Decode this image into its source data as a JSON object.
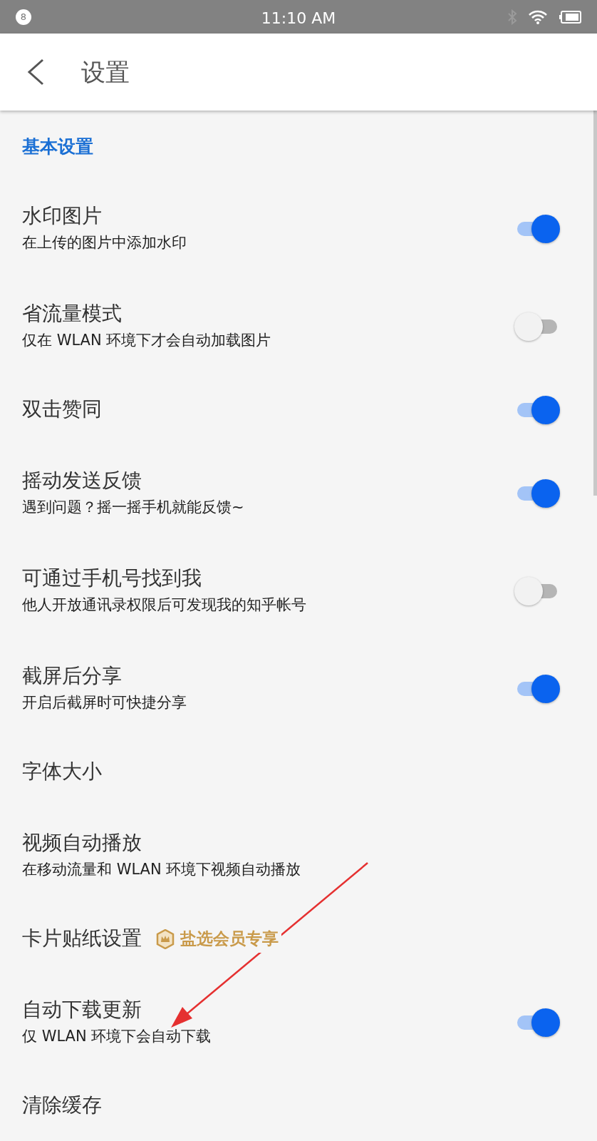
{
  "status_bar": {
    "notification_count": "8",
    "time": "11:10 AM"
  },
  "app_bar": {
    "title": "设置"
  },
  "section": {
    "title": "基本设置"
  },
  "settings": [
    {
      "kind": "toggle",
      "title": "水印图片",
      "subtitle": "在上传的图片中添加水印",
      "on": true
    },
    {
      "kind": "toggle",
      "title": "省流量模式",
      "subtitle": "仅在 WLAN 环境下才会自动加载图片",
      "on": false
    },
    {
      "kind": "toggle",
      "title": "双击赞同",
      "on": true
    },
    {
      "kind": "toggle",
      "title": "摇动发送反馈",
      "subtitle": "遇到问题？摇一摇手机就能反馈~",
      "on": true
    },
    {
      "kind": "toggle",
      "title": "可通过手机号找到我",
      "subtitle": "他人开放通讯录权限后可发现我的知乎帐号",
      "on": false
    },
    {
      "kind": "toggle",
      "title": "截屏后分享",
      "subtitle": "开启后截屏时可快捷分享",
      "on": true
    },
    {
      "kind": "link",
      "title": "字体大小"
    },
    {
      "kind": "link",
      "title": "视频自动播放",
      "subtitle": "在移动流量和 WLAN 环境下视频自动播放"
    },
    {
      "kind": "badge",
      "title": "卡片贴纸设置",
      "badge": "盐选会员专享"
    },
    {
      "kind": "toggle",
      "title": "自动下载更新",
      "subtitle": "仅 WLAN 环境下会自动下载",
      "on": true
    },
    {
      "kind": "link",
      "title": "清除缓存"
    }
  ]
}
